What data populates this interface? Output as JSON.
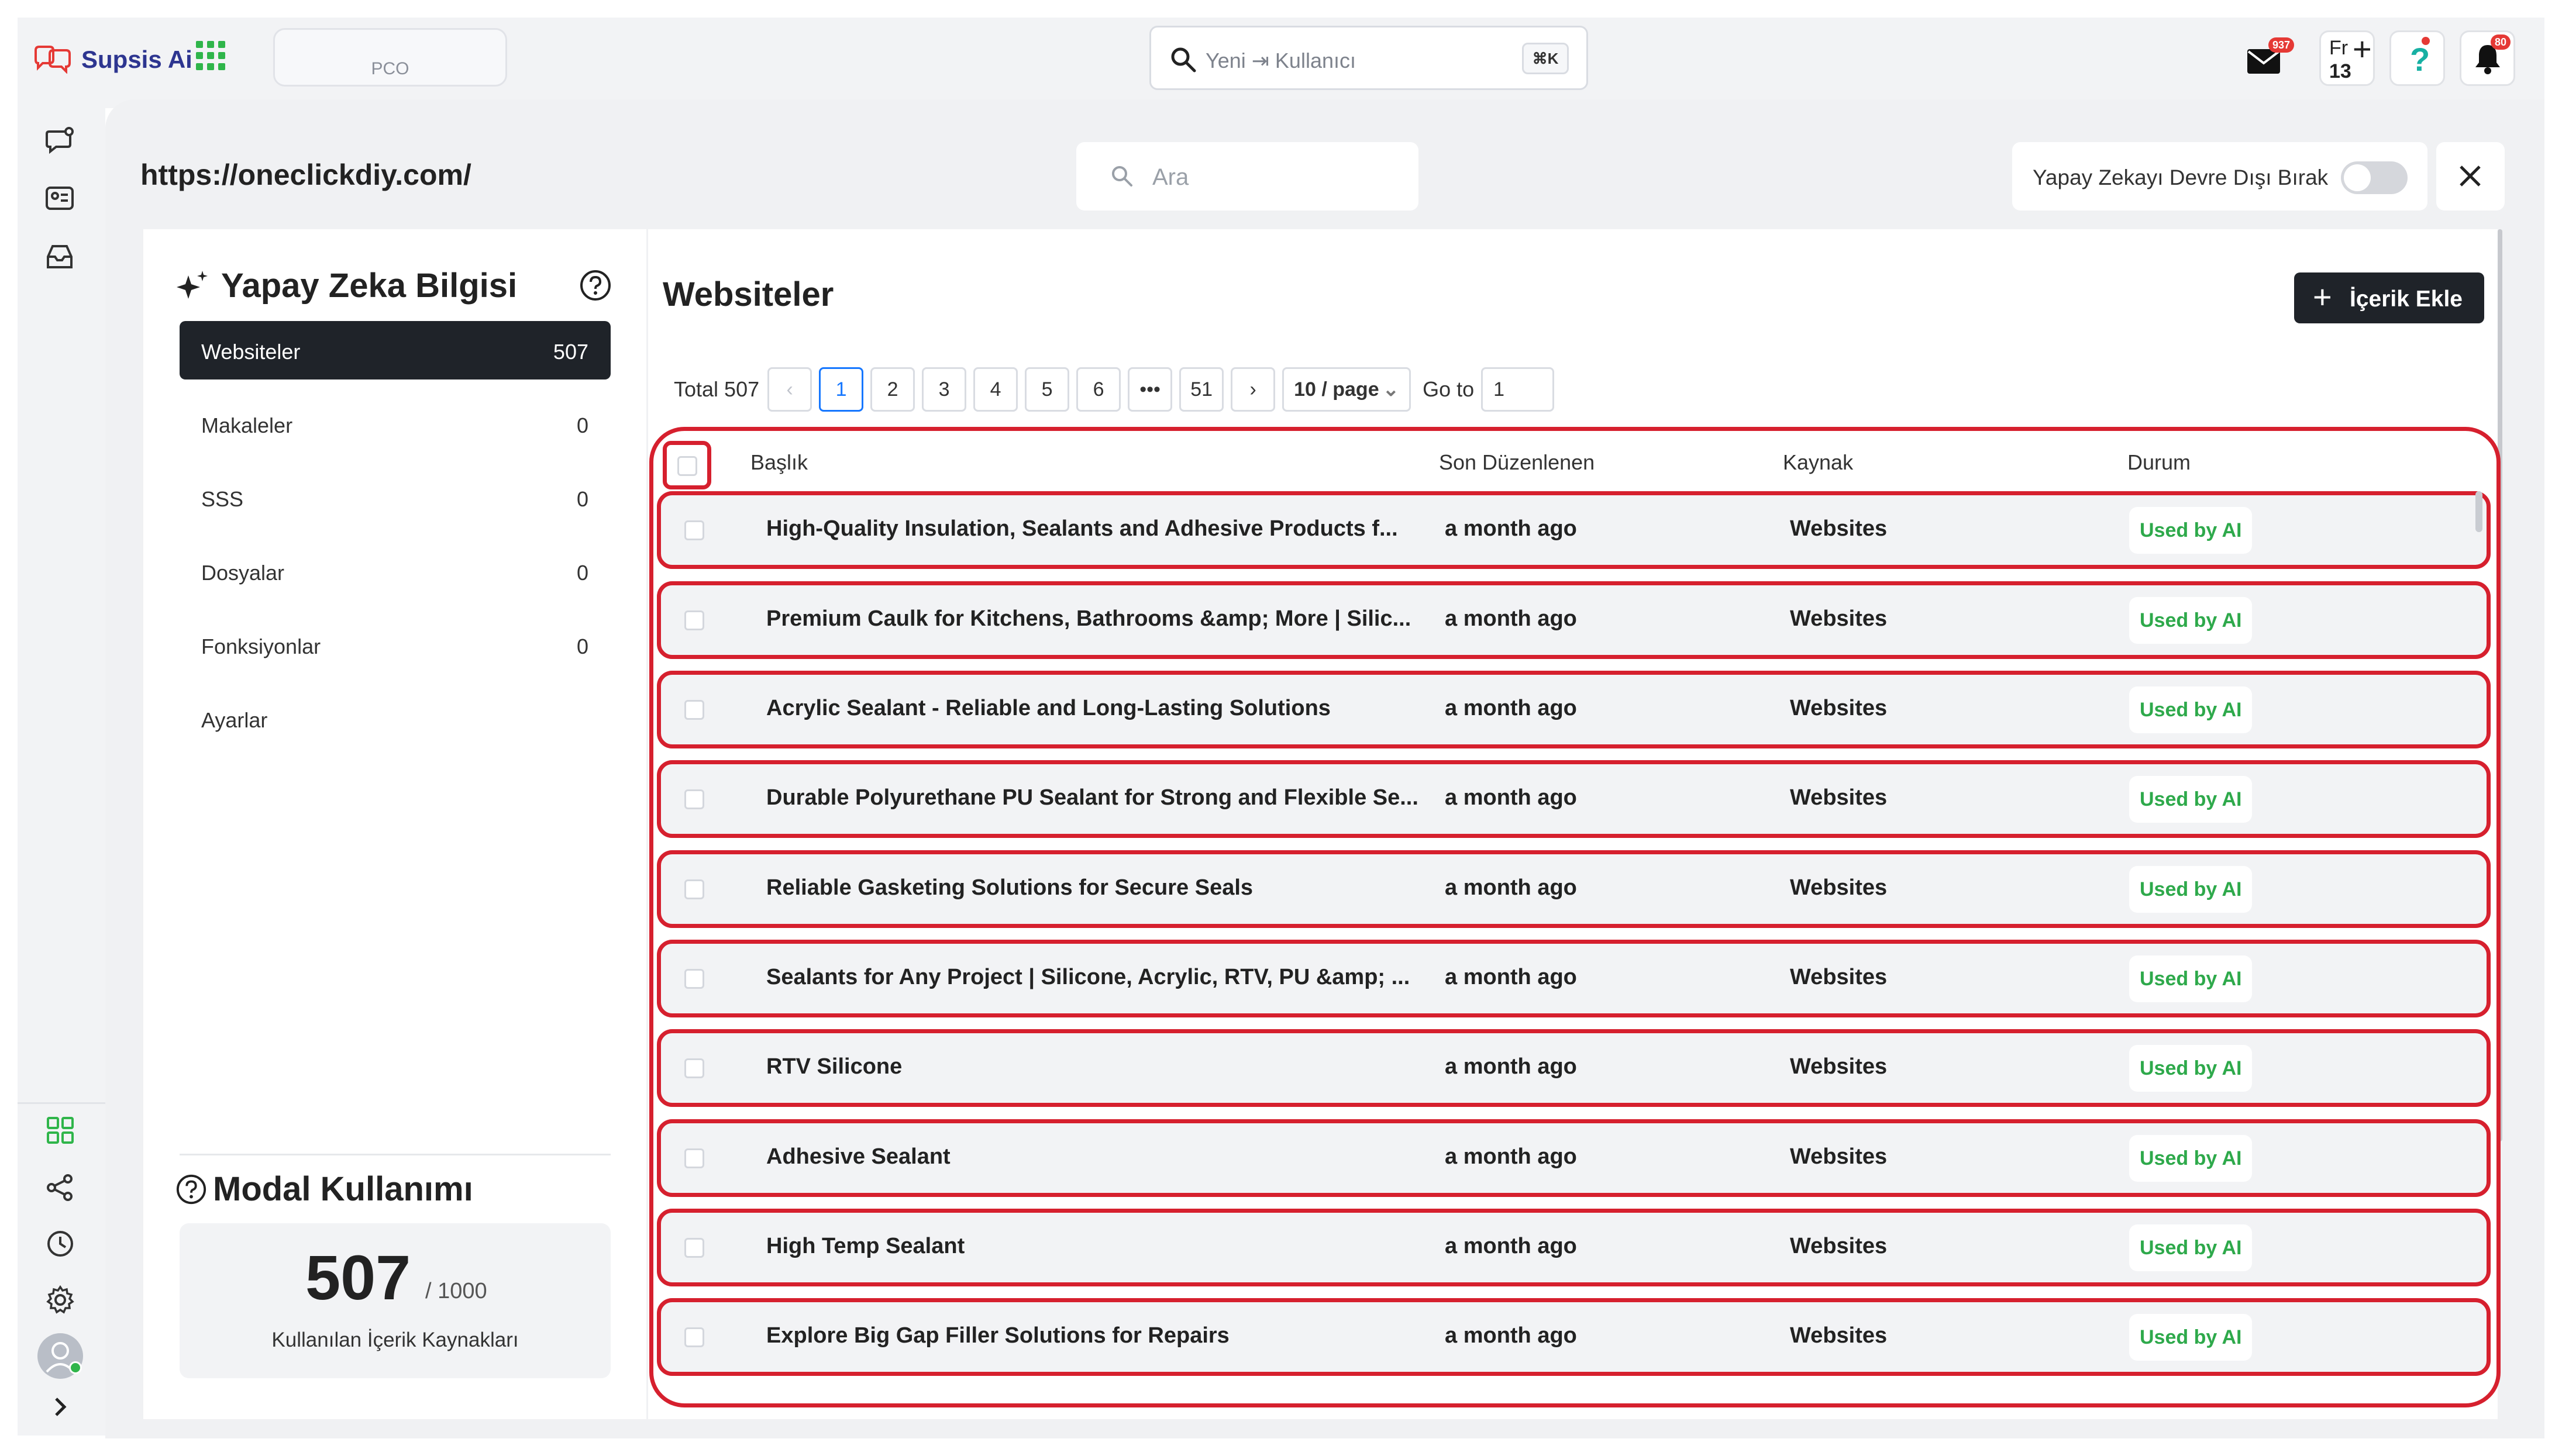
{
  "app": {
    "name": "Supsis Ai",
    "workspace_label": "PCO"
  },
  "global_search": {
    "placeholder": "Yeni ⇥ Kullanıcı",
    "shortcut": "⌘K"
  },
  "top_right": {
    "mail_badge": "937",
    "notif_badge": "80",
    "user_initials": "Fr",
    "user_number": "13",
    "help_label": "?"
  },
  "header": {
    "url": "https://oneclickdiy.com/",
    "search_placeholder": "Ara",
    "ai_toggle_label": "Yapay Zekayı Devre Dışı Bırak",
    "ai_toggle_on": false
  },
  "sidebar": {
    "title": "Yapay Zeka Bilgisi",
    "items": [
      {
        "label": "Websiteler",
        "count": "507",
        "active": true
      },
      {
        "label": "Makaleler",
        "count": "0"
      },
      {
        "label": "SSS",
        "count": "0"
      },
      {
        "label": "Dosyalar",
        "count": "0"
      },
      {
        "label": "Fonksiyonlar",
        "count": "0"
      },
      {
        "label": "Ayarlar",
        "count": ""
      }
    ],
    "usage_title": "Modal Kullanımı",
    "usage_value": "507",
    "usage_limit": "/ 1000",
    "usage_caption": "Kullanılan İçerik Kaynakları"
  },
  "content": {
    "title": "Websiteler",
    "add_button": "İçerik Ekle",
    "pagination": {
      "total": "Total 507",
      "prev": "‹",
      "pages": [
        "1",
        "2",
        "3",
        "4",
        "5",
        "6"
      ],
      "ellipsis": "•••",
      "last": "51",
      "next": "›",
      "current": "1",
      "page_size": "10 / page",
      "goto_label": "Go to",
      "goto_value": "1"
    },
    "columns": [
      "Başlık",
      "Son Düzenlenen",
      "Kaynak",
      "Durum"
    ],
    "rows": [
      {
        "title": "High-Quality Insulation, Sealants and Adhesive Products f...",
        "date": "a month ago",
        "source": "Websites",
        "status": "Used by AI"
      },
      {
        "title": "Premium Caulk for Kitchens, Bathrooms &amp; More | Silic...",
        "date": "a month ago",
        "source": "Websites",
        "status": "Used by AI"
      },
      {
        "title": "Acrylic Sealant - Reliable and Long-Lasting Solutions",
        "date": "a month ago",
        "source": "Websites",
        "status": "Used by AI"
      },
      {
        "title": "Durable Polyurethane PU Sealant for Strong and Flexible Se...",
        "date": "a month ago",
        "source": "Websites",
        "status": "Used by AI"
      },
      {
        "title": "Reliable Gasketing Solutions for Secure Seals",
        "date": "a month ago",
        "source": "Websites",
        "status": "Used by AI"
      },
      {
        "title": "Sealants for Any Project | Silicone, Acrylic, RTV, PU &amp; ...",
        "date": "a month ago",
        "source": "Websites",
        "status": "Used by AI"
      },
      {
        "title": "RTV Silicone",
        "date": "a month ago",
        "source": "Websites",
        "status": "Used by AI"
      },
      {
        "title": "Adhesive Sealant",
        "date": "a month ago",
        "source": "Websites",
        "status": "Used by AI"
      },
      {
        "title": "High Temp Sealant",
        "date": "a month ago",
        "source": "Websites",
        "status": "Used by AI"
      },
      {
        "title": "Explore Big Gap Filler Solutions for Repairs",
        "date": "a month ago",
        "source": "Websites",
        "status": "Used by AI"
      }
    ]
  },
  "colors": {
    "accent": "#1677ff",
    "highlight": "#d6202e",
    "status_green": "#2ea94b",
    "dark": "#1f2329"
  }
}
